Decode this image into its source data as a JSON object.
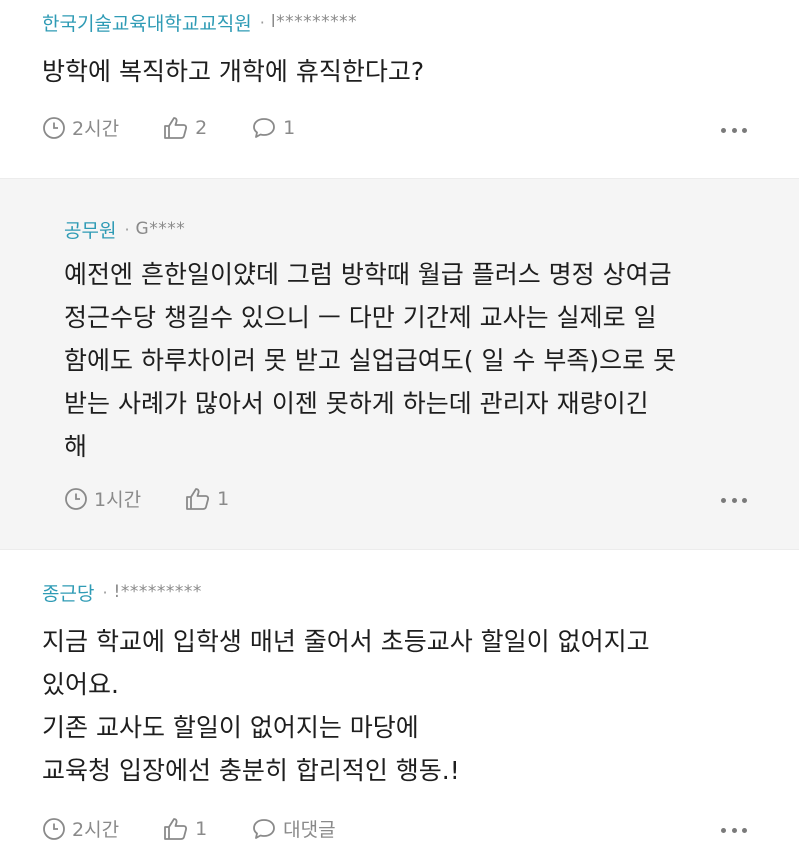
{
  "comments": [
    {
      "author": "한국기술교육대학교교직원",
      "uid": "l*********",
      "text": "방학에 복직하고 개학에 휴직한다고?",
      "time": "2시간",
      "likes": "2",
      "replies": "1"
    },
    {
      "author": "공무원",
      "uid": "G****",
      "text": "예전엔 흔한일이얐데 그럼 방학때 월급 플러스 명정 상여금\n정근수당 챙길수 있으니 ㅡ 다만 기간제 교사는 실제로 일\n함에도 하루차이러 못 받고 실업급여도( 일 수 부족)으로 못\n받는 사례가 많아서 이젠 못하게 하는데 관리자 재량이긴\n해",
      "time": "1시간",
      "likes": "1"
    },
    {
      "author": "종근당",
      "uid": "!*********",
      "text": "지금 학교에 입학생 매년 줄어서 초등교사 할일이 없어지고\n있어요.\n기존 교사도 할일이 없어지는 마당에\n교육청 입장에선 충분히 합리적인 행동.!",
      "time": "2시간",
      "likes": "1",
      "reply_label": "대댓글"
    }
  ],
  "separator": "·"
}
